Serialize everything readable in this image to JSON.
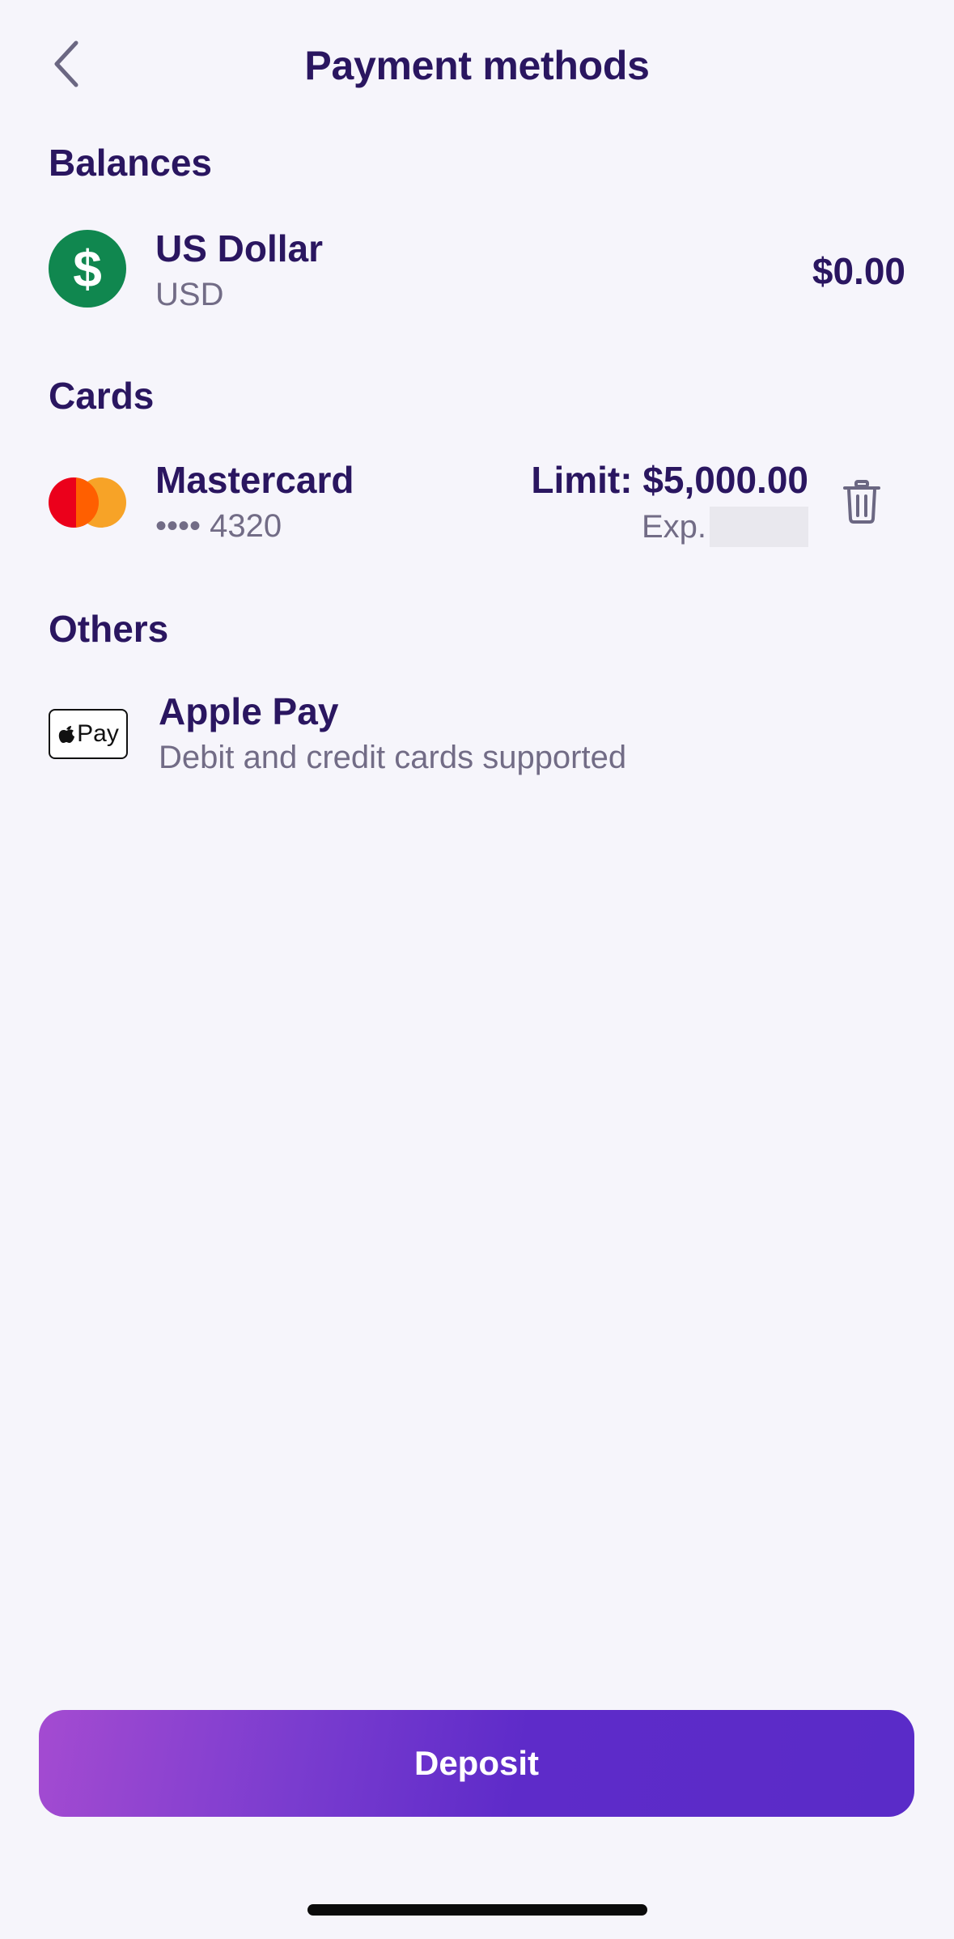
{
  "header": {
    "title": "Payment methods",
    "back_icon": "chevron-left-icon"
  },
  "balances": {
    "title": "Balances",
    "items": [
      {
        "name": "US Dollar",
        "code": "USD",
        "amount": "$0.00",
        "icon_symbol": "$",
        "icon_color": "#10874f"
      }
    ]
  },
  "cards": {
    "title": "Cards",
    "items": [
      {
        "name": "Mastercard",
        "masked_number": "•••• 4320",
        "limit": "Limit: $5,000.00",
        "exp_label": "Exp."
      }
    ]
  },
  "others": {
    "title": "Others",
    "items": [
      {
        "name": "Apple Pay",
        "description": "Debit and credit cards supported",
        "badge_text": "Pay"
      }
    ]
  },
  "footer": {
    "deposit_label": "Deposit"
  },
  "colors": {
    "primary_text": "#2a1660",
    "secondary_text": "#726c86",
    "background": "#f6f5fb",
    "accent": "#5e2bc9"
  }
}
